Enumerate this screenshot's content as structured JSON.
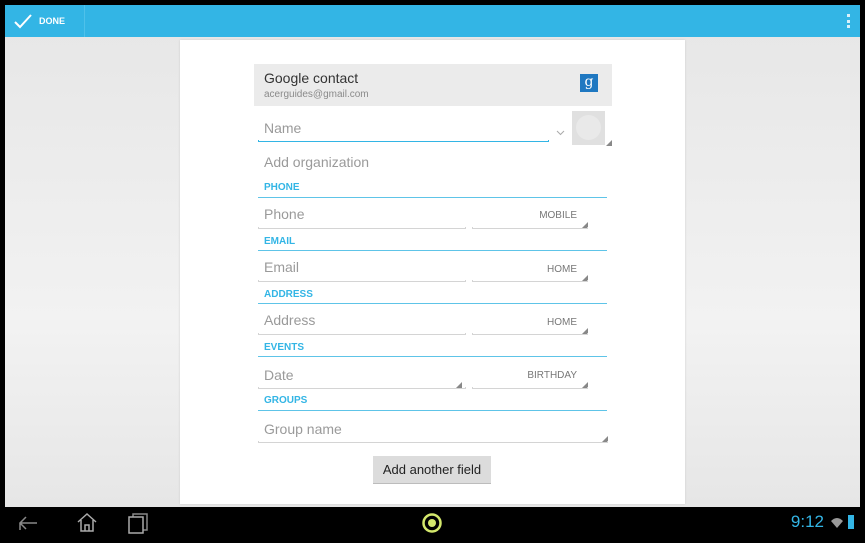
{
  "action_bar": {
    "done_label": "DONE",
    "overflow_icon": "overflow-menu-icon"
  },
  "account": {
    "title": "Google contact",
    "email": "acerguides@gmail.com",
    "icon_letter": "g"
  },
  "name": {
    "placeholder": "Name"
  },
  "organization": {
    "label": "Add organization"
  },
  "sections": {
    "phone": {
      "header": "PHONE",
      "placeholder": "Phone",
      "type": "MOBILE"
    },
    "email": {
      "header": "EMAIL",
      "placeholder": "Email",
      "type": "HOME"
    },
    "address": {
      "header": "ADDRESS",
      "placeholder": "Address",
      "type": "HOME"
    },
    "events": {
      "header": "EVENTS",
      "placeholder": "Date",
      "type": "BIRTHDAY"
    },
    "groups": {
      "header": "GROUPS",
      "placeholder": "Group name"
    }
  },
  "add_field_label": "Add another field",
  "status": {
    "time": "9:12"
  },
  "colors": {
    "accent": "#33b5e5"
  }
}
